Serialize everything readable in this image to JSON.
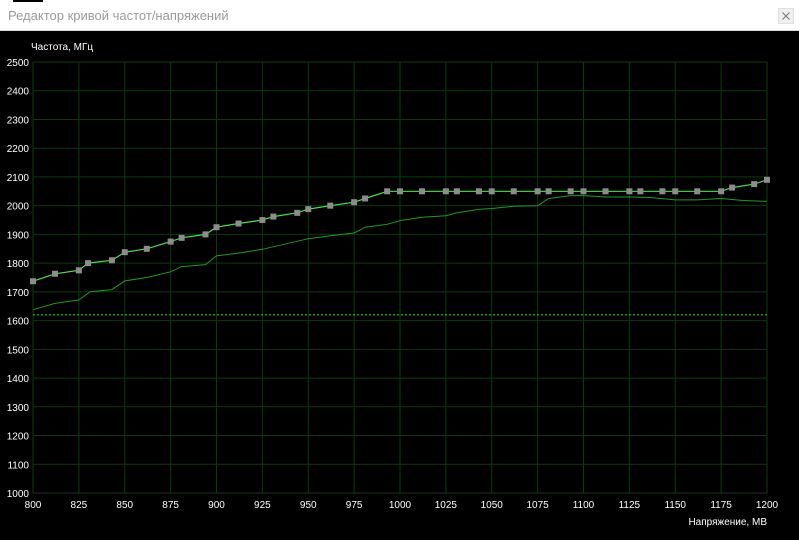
{
  "window": {
    "title": "Редактор кривой частот/напряжений",
    "close_icon": "close-icon"
  },
  "colors": {
    "background": "#000000",
    "grid": "#0c3a0c",
    "curve": "#4ddf4d",
    "curve_marker": "#8c8c8c",
    "current_freq": "#1f9a1f",
    "baseline": "#2ee82e",
    "axis_text": "#ffffff"
  },
  "chart_data": {
    "type": "line",
    "ylabel": "Частота, МГц",
    "xlabel": "Напряжение, МВ",
    "xlim": [
      800,
      1200
    ],
    "ylim": [
      1000,
      2500
    ],
    "x_ticks": [
      800,
      825,
      850,
      875,
      900,
      925,
      950,
      975,
      1000,
      1025,
      1050,
      1075,
      1100,
      1125,
      1150,
      1175,
      1200
    ],
    "y_ticks": [
      1000,
      1100,
      1200,
      1300,
      1400,
      1500,
      1600,
      1700,
      1800,
      1900,
      2000,
      2100,
      2200,
      2300,
      2400,
      2500
    ],
    "grid": true,
    "series": [
      {
        "role": "curve-points",
        "x": [
          800,
          812,
          825,
          830,
          843,
          850,
          862,
          875,
          881,
          894,
          900,
          912,
          925,
          931,
          944,
          950,
          962,
          975,
          981,
          993,
          1000,
          1012,
          1025,
          1031,
          1043,
          1050,
          1062,
          1075,
          1081,
          1093,
          1100,
          1112,
          1125,
          1131,
          1143,
          1150,
          1162,
          1175,
          1181,
          1193,
          1200
        ],
        "y": [
          1737,
          1763,
          1775,
          1800,
          1810,
          1838,
          1850,
          1875,
          1888,
          1900,
          1925,
          1938,
          1950,
          1962,
          1975,
          1988,
          2000,
          2012,
          2025,
          2050,
          2050,
          2050,
          2050,
          2050,
          2050,
          2050,
          2050,
          2050,
          2050,
          2050,
          2050,
          2050,
          2050,
          2050,
          2050,
          2050,
          2050,
          2050,
          2063,
          2075,
          2090
        ]
      },
      {
        "role": "current-frequency",
        "x": [
          800,
          812,
          825,
          831,
          843,
          850,
          862,
          875,
          881,
          894,
          900,
          912,
          925,
          937,
          950,
          962,
          975,
          981,
          993,
          1000,
          1012,
          1025,
          1031,
          1043,
          1050,
          1062,
          1075,
          1081,
          1093,
          1100,
          1112,
          1125,
          1137,
          1150,
          1162,
          1175,
          1187,
          1200
        ],
        "y": [
          1638,
          1660,
          1672,
          1700,
          1708,
          1738,
          1750,
          1770,
          1788,
          1795,
          1825,
          1835,
          1848,
          1866,
          1885,
          1895,
          1905,
          1925,
          1935,
          1948,
          1960,
          1965,
          1975,
          1987,
          1990,
          1998,
          2000,
          2025,
          2035,
          2035,
          2030,
          2030,
          2028,
          2020,
          2020,
          2025,
          2018,
          2015
        ]
      }
    ],
    "baseline_frequency": 1620
  }
}
